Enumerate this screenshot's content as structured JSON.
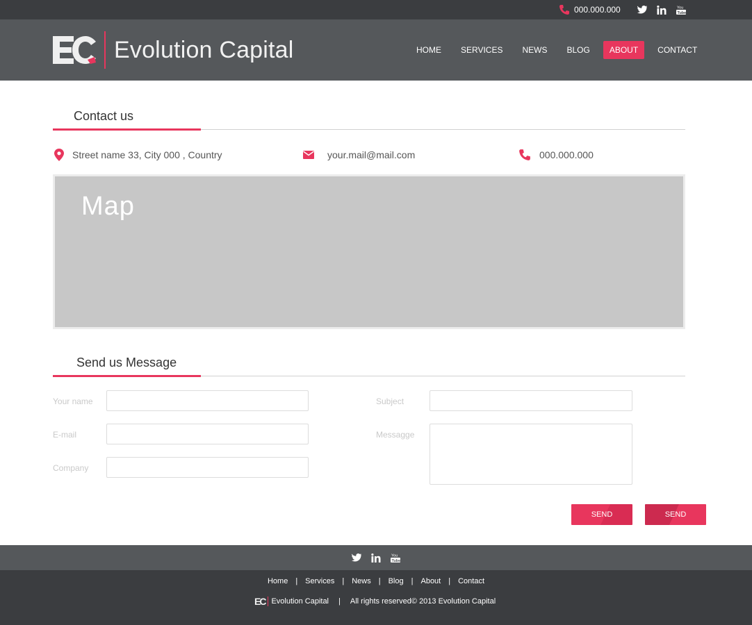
{
  "topbar": {
    "phone": "000.000.000",
    "socials": [
      "twitter-icon",
      "linkedin-icon",
      "youtube-icon"
    ]
  },
  "header": {
    "logo_mark": "EC",
    "logo_text": "Evolution Capital",
    "nav": [
      {
        "label": "HOME",
        "active": false
      },
      {
        "label": "SERVICES",
        "active": false
      },
      {
        "label": "NEWS",
        "active": false
      },
      {
        "label": "BLOG",
        "active": false
      },
      {
        "label": "ABOUT",
        "active": true
      },
      {
        "label": "CONTACT",
        "active": false
      }
    ]
  },
  "contact": {
    "title": "Contact us",
    "address": "Street name 33, City 000 , Country",
    "email": "your.mail@mail.com",
    "phone": "000.000.000",
    "map_label": "Map"
  },
  "form": {
    "title": "Send us Message",
    "name_label": "Your name",
    "email_label": "E-mail",
    "company_label": "Company",
    "subject_label": "Subject",
    "message_label": "Messagge",
    "send_label_1": "SEND",
    "send_label_2": "SEND"
  },
  "footer": {
    "links": [
      "Home",
      "Services",
      "News",
      "Blog",
      "About",
      "Contact"
    ],
    "logo_mark": "EC",
    "logo_text": "Evolution Capital",
    "copyright": "All rights reserved© 2013 Evolution Capital"
  },
  "colors": {
    "accent": "#e8365d",
    "header_bg": "#55585b",
    "topbar_bg": "#3b3d40",
    "map_bg": "#c7c7c7"
  }
}
